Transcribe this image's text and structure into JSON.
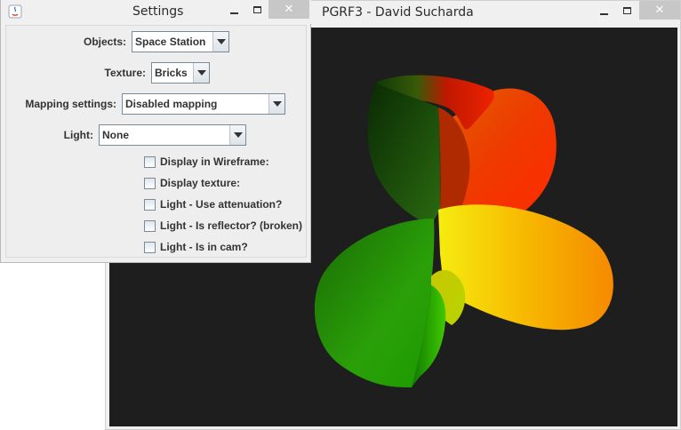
{
  "main_window": {
    "title": "PGRF3 - David Sucharda",
    "close_glyph": "✕",
    "icons": {
      "minimize": "minimize-icon",
      "maximize": "maximize-icon",
      "close": "close-icon"
    }
  },
  "settings_window": {
    "title": "Settings",
    "close_glyph": "✕",
    "app_icon": "java-icon",
    "objects": {
      "label": "Objects:",
      "value": "Space Station"
    },
    "texture": {
      "label": "Texture:",
      "value": "Bricks"
    },
    "mapping": {
      "label": "Mapping settings:",
      "value": "Disabled mapping"
    },
    "light": {
      "label": "Light:",
      "value": "None"
    },
    "checkboxes": [
      {
        "label": "Display in Wireframe:",
        "checked": false
      },
      {
        "label": "Display texture:",
        "checked": false
      },
      {
        "label": "Light - Use attenuation?",
        "checked": false
      },
      {
        "label": "Light - Is reflector? (broken)",
        "checked": false
      },
      {
        "label": "Light - Is in cam?",
        "checked": false
      }
    ]
  },
  "colors": {
    "viewport_bg": "#1e1e1e",
    "shape_red": "#e81000",
    "shape_orange": "#f57a00",
    "shape_yellow": "#f2e400",
    "shape_green": "#1fb000",
    "shape_dark_green": "#0e3a05"
  }
}
